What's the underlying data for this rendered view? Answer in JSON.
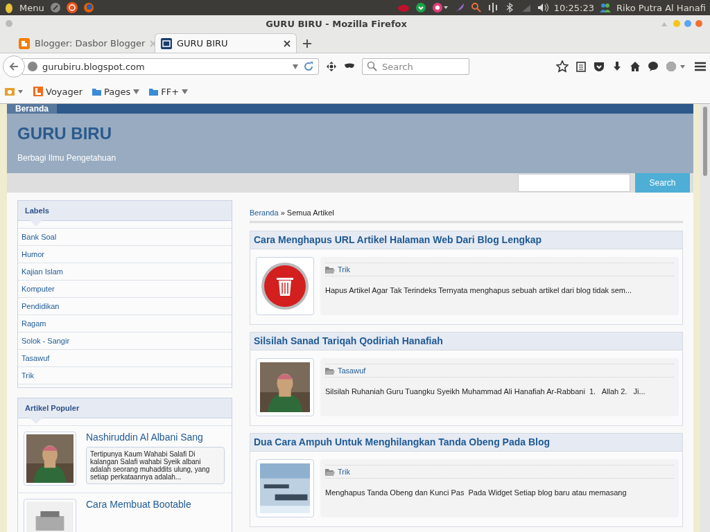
{
  "desktop_panel": {
    "menu": "Menu",
    "clock": "10:25:23",
    "user": "Riko Putra Al Hanafi"
  },
  "window": {
    "title": "GURU BIRU - Mozilla Firefox"
  },
  "tabs": [
    {
      "label": "Blogger: Dasbor Blogger",
      "selected": false,
      "kind": "blogger"
    },
    {
      "label": "GURU BIRU",
      "selected": true,
      "kind": "site"
    }
  ],
  "address_bar": {
    "value": "gurubiru.blogspot.com"
  },
  "search": {
    "placeholder": "Search"
  },
  "bookmarks": [
    {
      "label": "Voyager",
      "kind": "site"
    },
    {
      "label": "Pages",
      "kind": "folder"
    },
    {
      "label": "FF+",
      "kind": "folder"
    }
  ],
  "blog": {
    "nav": [
      {
        "label": "Beranda",
        "selected": true
      }
    ],
    "title": "GURU BIRU",
    "description": "Berbagi Ilmu Pengetahuan",
    "search_button": "Search",
    "labels_title": "Labels",
    "labels": [
      "Bank Soal",
      "Humor",
      "Kajian Islam",
      "Komputer",
      "Pendidikan",
      "Ragam",
      "Solok - Sangir",
      "Tasawuf",
      "Trik"
    ],
    "popular_title": "Artikel Populer",
    "popular": [
      {
        "title": "Nashiruddin Al Albani Sang",
        "snippet": "Tertipunya Kaum Wahabi Salafi Di kalangan Salafi wahabi Syeik albani adalah seorang muhaddits ulung, yang setiap perkataannya adalah...",
        "kind": "person"
      },
      {
        "title": "Cara Membuat Bootable",
        "kind": "device"
      }
    ],
    "breadcrumb": {
      "home": "Beranda",
      "separator": "»",
      "current": "Semua Artikel"
    },
    "posts": [
      {
        "title": "Cara Menghapus URL Artikel Halaman Web Dari Blog Lengkap",
        "label": "Trik",
        "snippet": "Hapus Artikel Agar Tak Terindeks Ternyata menghapus sebuah artikel dari blog tidak sem...",
        "kind": "trash"
      },
      {
        "title": "Silsilah Sanad Tariqah Qodiriah Hanafiah",
        "label": "Tasawuf",
        "snippet": "Silsilah Ruhaniah Guru Tuangku Syeikh Muhammad Ali Hanafiah Ar-Rabbani  1.   Allah 2.   Ji...",
        "kind": "person"
      },
      {
        "title": "Dua Cara Ampuh Untuk Menghilangkan Tanda Obeng Pada Blog",
        "label": "Trik",
        "snippet": "Menghapus Tanda Obeng dan Kunci Pas  Pada Widget Setiap blog baru atau memasang",
        "kind": "code"
      }
    ]
  }
}
